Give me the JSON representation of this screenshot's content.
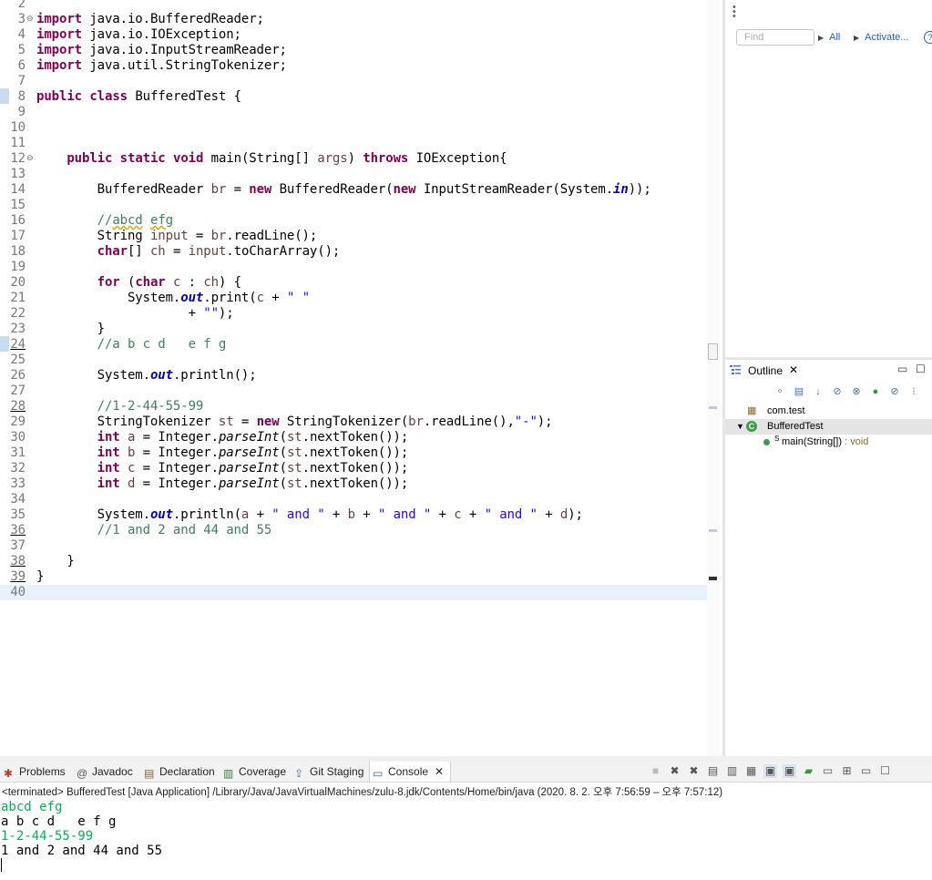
{
  "editor": {
    "lines": [
      {
        "n": "2",
        "html": ""
      },
      {
        "n": "3",
        "fold": "⊖",
        "html": "<span class=\"kw\">import</span> java.io.BufferedReader;"
      },
      {
        "n": "4",
        "html": "<span class=\"kw\">import</span> java.io.IOException;"
      },
      {
        "n": "5",
        "html": "<span class=\"kw\">import</span> java.io.InputStreamReader;"
      },
      {
        "n": "6",
        "html": "<span class=\"kw\">import</span> java.util.StringTokenizer;"
      },
      {
        "n": "7",
        "html": ""
      },
      {
        "n": "8",
        "html": "<span class=\"kw\">public</span> <span class=\"kw\">class</span> BufferedTest {"
      },
      {
        "n": "9",
        "html": ""
      },
      {
        "n": "10",
        "html": ""
      },
      {
        "n": "11",
        "html": ""
      },
      {
        "n": "12",
        "fold": "⊖",
        "html": "    <span class=\"kw\">public</span> <span class=\"kw\">static</span> <span class=\"kw\">void</span> main(String[] <span class=\"var\">args</span>) <span class=\"kw\">throws</span> IOException{"
      },
      {
        "n": "13",
        "html": ""
      },
      {
        "n": "14",
        "html": "        BufferedReader <span class=\"var\">br</span> = <span class=\"kw\">new</span> BufferedReader(<span class=\"kw\">new</span> InputStreamReader(System.<span class=\"fld\">in</span>));"
      },
      {
        "n": "15",
        "html": ""
      },
      {
        "n": "16",
        "html": "        <span class=\"com\">//<span class=\"squig\">abcd</span> <span class=\"squig\">efg</span></span>"
      },
      {
        "n": "17",
        "html": "        String <span class=\"var\">input</span> = <span class=\"var\">br</span>.readLine();"
      },
      {
        "n": "18",
        "html": "        <span class=\"kw\">char</span>[] <span class=\"var\">ch</span> = <span class=\"var\">input</span>.toCharArray();"
      },
      {
        "n": "19",
        "html": ""
      },
      {
        "n": "20",
        "html": "        <span class=\"kw\">for</span> (<span class=\"kw\">char</span> <span class=\"var\">c</span> : <span class=\"var\">ch</span>) {"
      },
      {
        "n": "21",
        "html": "            System.<span class=\"fld\">out</span>.print(<span class=\"var\">c</span> + <span class=\"str\">\" \"</span>"
      },
      {
        "n": "22",
        "html": "                    + <span class=\"str\">\"\"</span>);"
      },
      {
        "n": "23",
        "html": "        }"
      },
      {
        "n": "24",
        "changed": true,
        "html": "        <span class=\"com\">//a b c d   e f g</span>"
      },
      {
        "n": "25",
        "html": ""
      },
      {
        "n": "26",
        "html": "        System.<span class=\"fld\">out</span>.println();"
      },
      {
        "n": "27",
        "html": ""
      },
      {
        "n": "28",
        "changed": true,
        "html": "        <span class=\"com\">//1-2-44-55-99</span>"
      },
      {
        "n": "29",
        "html": "        StringTokenizer <span class=\"var\">st</span> = <span class=\"kw\">new</span> StringTokenizer(<span class=\"var\">br</span>.readLine(),<span class=\"str\">\"-\"</span>);"
      },
      {
        "n": "30",
        "html": "        <span class=\"kw\">int</span> <span class=\"var\">a</span> = Integer.<span class=\"static\">parseInt</span>(<span class=\"var\">st</span>.nextToken());"
      },
      {
        "n": "31",
        "html": "        <span class=\"kw\">int</span> <span class=\"var\">b</span> = Integer.<span class=\"static\">parseInt</span>(<span class=\"var\">st</span>.nextToken());"
      },
      {
        "n": "32",
        "html": "        <span class=\"kw\">int</span> <span class=\"var\">c</span> = Integer.<span class=\"static\">parseInt</span>(<span class=\"var\">st</span>.nextToken());"
      },
      {
        "n": "33",
        "html": "        <span class=\"kw\">int</span> <span class=\"var\">d</span> = Integer.<span class=\"static\">parseInt</span>(<span class=\"var\">st</span>.nextToken());"
      },
      {
        "n": "34",
        "html": ""
      },
      {
        "n": "35",
        "html": "        System.<span class=\"fld\">out</span>.println(<span class=\"var\">a</span> + <span class=\"str\">\" and \"</span> + <span class=\"var\">b</span> + <span class=\"str\">\" and \"</span> + <span class=\"var\">c</span> + <span class=\"str\">\" and \"</span> + <span class=\"var\">d</span>);"
      },
      {
        "n": "36",
        "changed": true,
        "html": "        <span class=\"com\">//1 and 2 and 44 and 55</span>"
      },
      {
        "n": "37",
        "html": ""
      },
      {
        "n": "38",
        "changed": true,
        "html": "    }"
      },
      {
        "n": "39",
        "changed": true,
        "html": "}"
      },
      {
        "n": "40",
        "current": true,
        "html": ""
      }
    ]
  },
  "task_pane": {
    "find_placeholder": "Find",
    "all_label": "All",
    "activate_label": "Activate...",
    "help_label": "?"
  },
  "outline": {
    "tab_label": "Outline",
    "tree": [
      {
        "label": "com.test",
        "icon": "package-icon"
      },
      {
        "label": "BufferedTest",
        "icon": "class-icon",
        "selected": true
      },
      {
        "label": "main(String[])",
        "suffix": " : void",
        "icon": "method-icon"
      }
    ]
  },
  "bottom": {
    "tabs": [
      {
        "label": "Problems",
        "icon": "problems-icon"
      },
      {
        "label": "Javadoc",
        "icon": "javadoc-icon"
      },
      {
        "label": "Declaration",
        "icon": "declaration-icon"
      },
      {
        "label": "Coverage",
        "icon": "coverage-icon"
      },
      {
        "label": "Git Staging",
        "icon": "git-staging-icon"
      },
      {
        "label": "Console",
        "icon": "console-icon",
        "active": true
      }
    ],
    "terminated_line": "<terminated> BufferedTest [Java Application] /Library/Java/JavaVirtualMachines/zulu-8.jdk/Contents/Home/bin/java  (2020. 8. 2. 오후 7:56:59 – 오후 7:57:12)",
    "output": [
      {
        "text": "abcd efg",
        "type": "input"
      },
      {
        "text": "a b c d   e f g",
        "type": "output"
      },
      {
        "text": "1-2-44-55-99",
        "type": "input"
      },
      {
        "text": "1 and 2 and 44 and 55",
        "type": "output"
      }
    ]
  },
  "colors": {
    "keyword": "#7f0055",
    "string": "#2a00ff",
    "comment": "#3f7f5f",
    "field": "#0000c0",
    "console_input": "#00b25a",
    "current_line": "#e8f2fe"
  }
}
